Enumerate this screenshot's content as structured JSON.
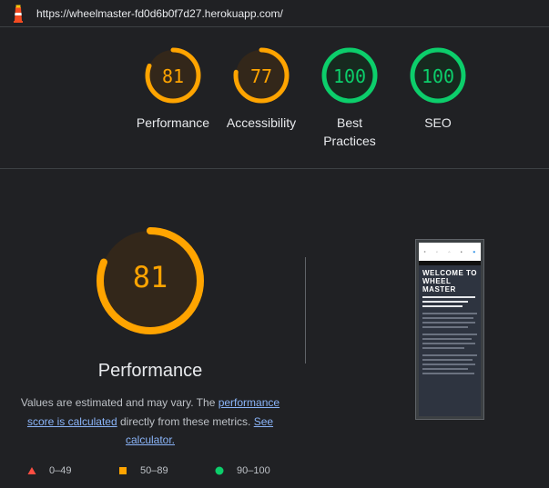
{
  "url": "https://wheelmaster-fd0d6b0f7d27.herokuapp.com/",
  "colors": {
    "pass": "#0cce6b",
    "average": "#ffa400",
    "fail": "#ff4e42"
  },
  "summary": [
    {
      "score": "81",
      "label": "Performance",
      "value": 0.81,
      "status": "average"
    },
    {
      "score": "77",
      "label": "Accessibility",
      "value": 0.77,
      "status": "average"
    },
    {
      "score": "100",
      "label": "Best Practices",
      "value": 1.0,
      "status": "pass"
    },
    {
      "score": "100",
      "label": "SEO",
      "value": 1.0,
      "status": "pass"
    }
  ],
  "main": {
    "score": "81",
    "value": 0.81,
    "title": "Performance",
    "desc_before": "Values are estimated and may vary. The ",
    "desc_link1": "performance score is calculated",
    "desc_middle": " directly from these metrics. ",
    "desc_link2": "See calculator."
  },
  "legend": [
    {
      "range": "0–49",
      "shape": "triangle-icon"
    },
    {
      "range": "50–89",
      "shape": "square-icon"
    },
    {
      "range": "90–100",
      "shape": "circle-icon"
    }
  ],
  "thumbnail": {
    "heading": "WELCOME TO WHEEL MASTER"
  }
}
